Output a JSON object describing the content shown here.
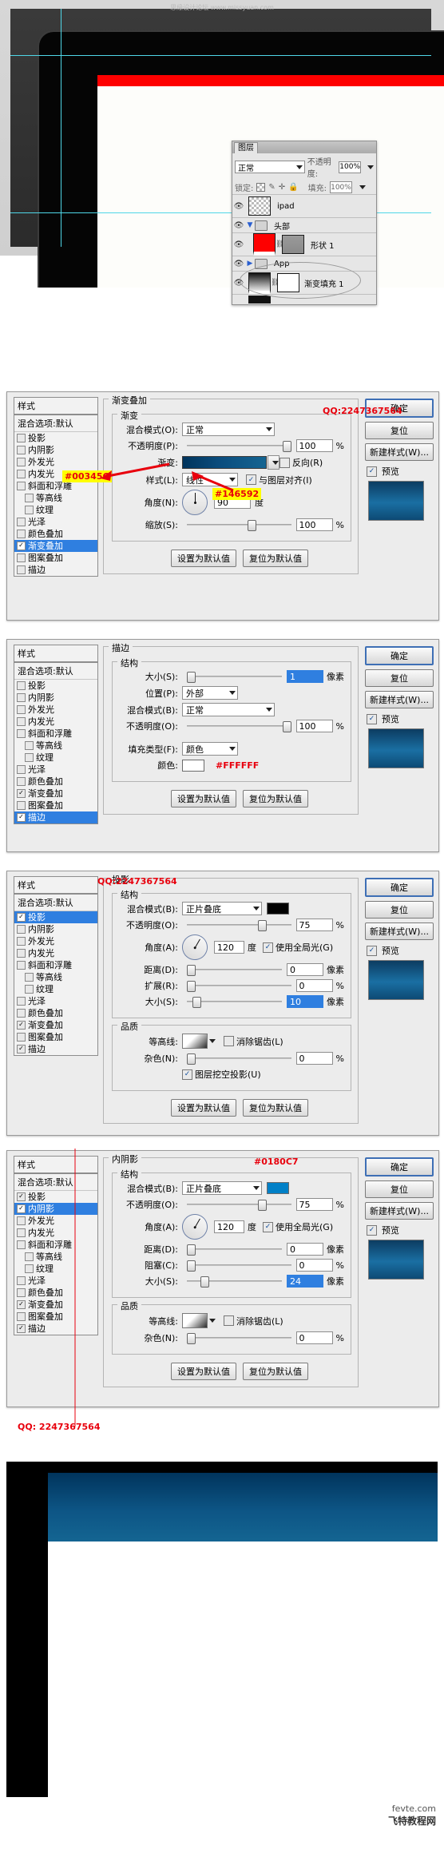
{
  "watermark_top": "思缘设计论坛 www.missyuan.com",
  "footer": {
    "site": "fevte.com",
    "cn": "飞特教程网"
  },
  "layers_panel": {
    "tab": "图层",
    "blend_mode": "正常",
    "opacity_label": "不透明度:",
    "opacity_value": "100%",
    "lock_label": "锁定:",
    "fill_label": "填充:",
    "fill_value": "100%",
    "rows": [
      {
        "name": "ipad",
        "kind": "layer-thumb"
      },
      {
        "name": "头部",
        "kind": "group-open"
      },
      {
        "name": "形状 1",
        "kind": "shape",
        "color": "#fe0000"
      },
      {
        "name": "App",
        "kind": "group-closed"
      },
      {
        "name": "渐变填充 1",
        "kind": "adjust"
      }
    ]
  },
  "style_list": {
    "header": "样式",
    "blending_options": "混合选项:默认",
    "items": [
      {
        "label": "投影",
        "indent": 0
      },
      {
        "label": "内阴影",
        "indent": 0
      },
      {
        "label": "外发光",
        "indent": 0
      },
      {
        "label": "内发光",
        "indent": 0
      },
      {
        "label": "斜面和浮雕",
        "indent": 0
      },
      {
        "label": "等高线",
        "indent": 1
      },
      {
        "label": "纹理",
        "indent": 1
      },
      {
        "label": "光泽",
        "indent": 0
      },
      {
        "label": "颜色叠加",
        "indent": 0
      },
      {
        "label": "渐变叠加",
        "indent": 0
      },
      {
        "label": "图案叠加",
        "indent": 0
      },
      {
        "label": "描边",
        "indent": 0
      }
    ]
  },
  "buttons": {
    "ok": "确定",
    "cancel": "复位",
    "new_style": "新建样式(W)...",
    "preview": "预览",
    "set_default": "设置为默认值",
    "reset_default": "复位为默认值"
  },
  "dialog_gradient": {
    "title": "渐变叠加",
    "group": "渐变",
    "blend_mode_label": "混合模式(O):",
    "blend_mode_value": "正常",
    "opacity_label": "不透明度(P):",
    "opacity_value": "100",
    "opacity_unit": "%",
    "gradient_label": "渐变:",
    "reverse_label": "反向(R)",
    "style_label": "样式(L):",
    "style_value": "线性",
    "align_label": "与图层对齐(I)",
    "angle_label": "角度(N):",
    "angle_value": "90",
    "angle_unit": "度",
    "scale_label": "缩放(S):",
    "scale_value": "100",
    "scale_unit": "%",
    "selected_style": "渐变叠加",
    "checked_styles": [
      "渐变叠加"
    ],
    "annotation_left": "#00345C",
    "annotation_right": "#146592",
    "qq": "QQ:2247367564",
    "gradient_from": "#00345C",
    "gradient_to": "#146592"
  },
  "dialog_stroke": {
    "title": "描边",
    "group": "结构",
    "size_label": "大小(S):",
    "size_value": "1",
    "size_unit": "像素",
    "position_label": "位置(P):",
    "position_value": "外部",
    "blend_mode_label": "混合模式(B):",
    "blend_mode_value": "正常",
    "opacity_label": "不透明度(O):",
    "opacity_value": "100",
    "opacity_unit": "%",
    "fill_type_label": "填充类型(F):",
    "fill_type_value": "颜色",
    "color_label": "颜色:",
    "color_value": "#FFFFFF",
    "selected_style": "描边",
    "checked_styles": [
      "渐变叠加",
      "描边"
    ]
  },
  "dialog_shadow": {
    "title": "投影",
    "group": "结构",
    "blend_mode_label": "混合模式(B):",
    "blend_mode_value": "正片叠底",
    "blend_color": "#000000",
    "opacity_label": "不透明度(O):",
    "opacity_value": "75",
    "opacity_unit": "%",
    "angle_label": "角度(A):",
    "angle_value": "120",
    "angle_unit": "度",
    "global_light_label": "使用全局光(G)",
    "distance_label": "距离(D):",
    "distance_value": "0",
    "distance_unit": "像素",
    "spread_label": "扩展(R):",
    "spread_value": "0",
    "spread_unit": "%",
    "size_label": "大小(S):",
    "size_value": "10",
    "size_unit": "像素",
    "quality_group": "品质",
    "contour_label": "等高线:",
    "antialias_label": "消除锯齿(L)",
    "noise_label": "杂色(N):",
    "noise_value": "0",
    "noise_unit": "%",
    "knockout_label": "图层挖空投影(U)",
    "selected_style": "投影",
    "checked_styles": [
      "投影",
      "渐变叠加",
      "描边"
    ],
    "qq": "QQ:2247367564"
  },
  "dialog_inner_shadow": {
    "title": "内阴影",
    "group": "结构",
    "blend_mode_label": "混合模式(B):",
    "blend_mode_value": "正片叠底",
    "blend_color": "#0180C7",
    "color_annotation": "#0180C7",
    "opacity_label": "不透明度(O):",
    "opacity_value": "75",
    "opacity_unit": "%",
    "angle_label": "角度(A):",
    "angle_value": "120",
    "angle_unit": "度",
    "global_light_label": "使用全局光(G)",
    "distance_label": "距离(D):",
    "distance_value": "0",
    "distance_unit": "像素",
    "choke_label": "阻塞(C):",
    "choke_value": "0",
    "choke_unit": "%",
    "size_label": "大小(S):",
    "size_value": "24",
    "size_unit": "像素",
    "quality_group": "品质",
    "contour_label": "等高线:",
    "antialias_label": "消除锯齿(L)",
    "noise_label": "杂色(N):",
    "noise_value": "0",
    "noise_unit": "%",
    "selected_style": "内阴影",
    "checked_styles": [
      "投影",
      "内阴影",
      "渐变叠加",
      "描边"
    ],
    "qq": "QQ: 2247367564"
  }
}
